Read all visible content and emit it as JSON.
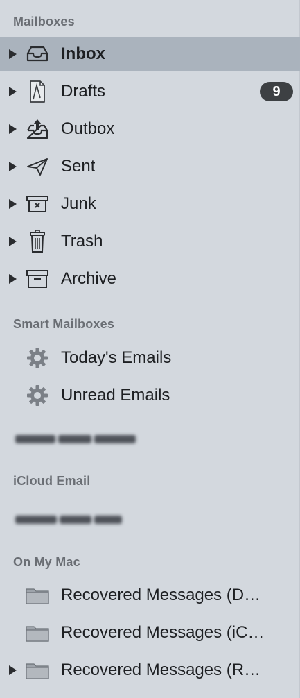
{
  "sections": {
    "mailboxes": "Mailboxes",
    "smart": "Smart Mailboxes",
    "icloud": "iCloud Email",
    "onmymac": "On My Mac"
  },
  "mailboxes": [
    {
      "label": "Inbox",
      "icon": "inbox-tray-icon",
      "selected": true
    },
    {
      "label": "Drafts",
      "icon": "draft-document-icon",
      "badge": "9"
    },
    {
      "label": "Outbox",
      "icon": "outbox-tray-icon"
    },
    {
      "label": "Sent",
      "icon": "paper-plane-icon"
    },
    {
      "label": "Junk",
      "icon": "junk-bin-icon"
    },
    {
      "label": "Trash",
      "icon": "trash-can-icon"
    },
    {
      "label": "Archive",
      "icon": "archive-box-icon"
    }
  ],
  "smart_mailboxes": [
    {
      "label": "Today's Emails",
      "icon": "gear-icon"
    },
    {
      "label": "Unread Emails",
      "icon": "gear-icon"
    }
  ],
  "local_mailboxes": [
    {
      "label": "Recovered Messages (D…",
      "icon": "folder-icon"
    },
    {
      "label": "Recovered Messages (iC…",
      "icon": "folder-icon"
    },
    {
      "label": "Recovered Messages (R…",
      "icon": "folder-icon"
    }
  ],
  "colors": {
    "sidebar_bg": "#d3d8de",
    "selected_row": "#aab3bd",
    "badge_bg": "#3d4043",
    "section_header": "#6a6e74"
  }
}
